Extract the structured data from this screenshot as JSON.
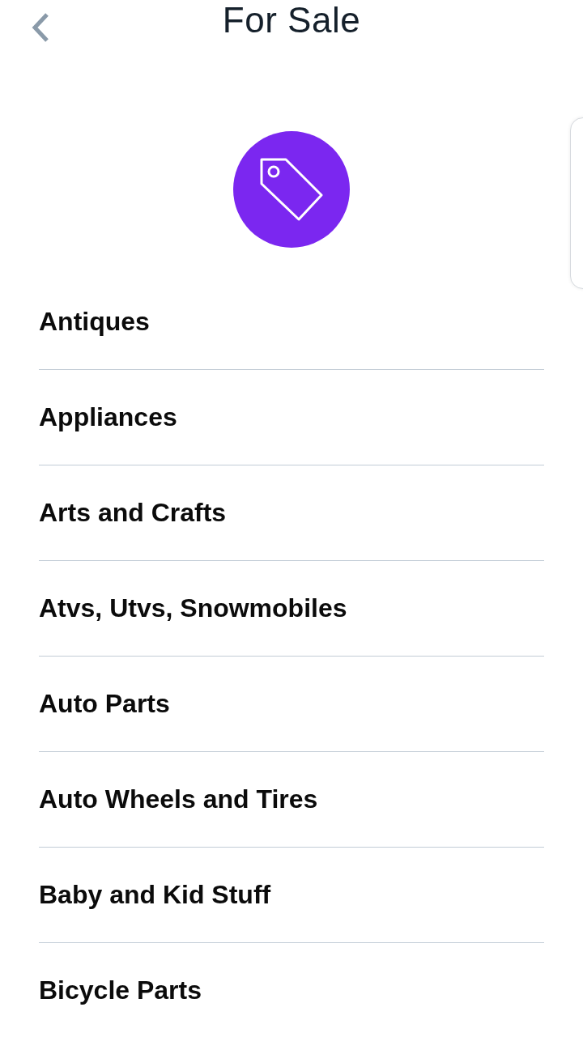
{
  "header": {
    "title": "For Sale"
  },
  "categories": [
    {
      "label": "Antiques"
    },
    {
      "label": "Appliances"
    },
    {
      "label": "Arts and Crafts"
    },
    {
      "label": "Atvs, Utvs, Snowmobiles"
    },
    {
      "label": "Auto Parts"
    },
    {
      "label": "Auto Wheels and Tires"
    },
    {
      "label": "Baby and Kid Stuff"
    },
    {
      "label": "Bicycle Parts"
    }
  ]
}
